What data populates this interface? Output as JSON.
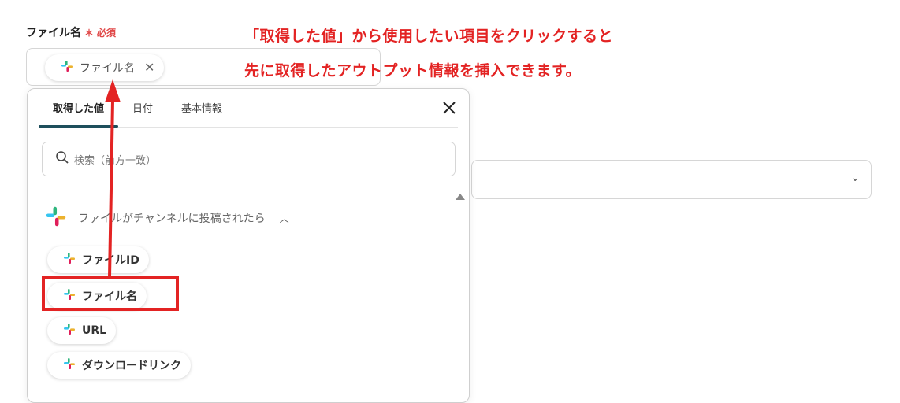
{
  "field": {
    "label": "ファイル名",
    "required_mark": "＊",
    "required_text": "必須",
    "chip_label": "ファイル名"
  },
  "annotation": {
    "line1": "「取得した値」から使用したい項目をクリックすると",
    "line2": "先に取得したアウトプット情報を挿入できます。"
  },
  "panel": {
    "tabs": [
      {
        "label": "取得した値",
        "active": true
      },
      {
        "label": "日付",
        "active": false
      },
      {
        "label": "基本情報",
        "active": false
      }
    ],
    "search_placeholder": "検索（前方一致）",
    "group_title": "ファイルがチャンネルに投稿されたら",
    "items": [
      {
        "label": "ファイルID"
      },
      {
        "label": "ファイル名"
      },
      {
        "label": "URL"
      },
      {
        "label": "ダウンロードリンク"
      }
    ]
  },
  "icons": {
    "slack": "slack-icon",
    "close": "close-icon",
    "search": "search-icon",
    "chevron": "chevron-down-icon",
    "caret": "caret-up-icon"
  },
  "colors": {
    "annotation_red": "#e32323",
    "tab_underline": "#1e4f5c",
    "required_red": "#e04848"
  }
}
